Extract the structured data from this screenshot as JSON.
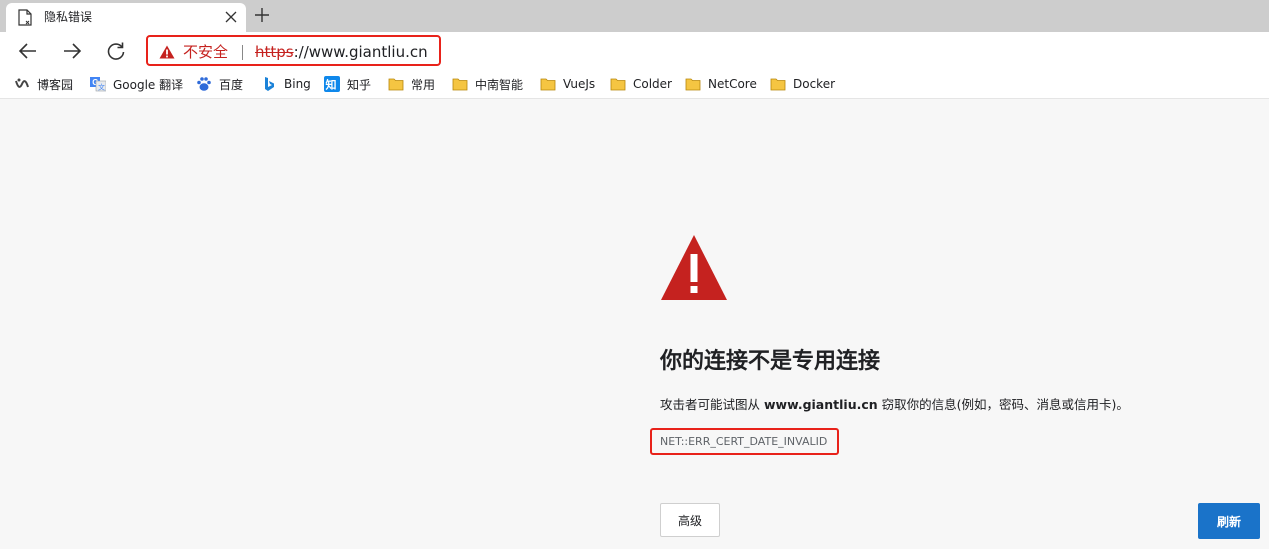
{
  "tab": {
    "title": "隐私错误",
    "icon": "document-icon"
  },
  "toolbar": {
    "address": {
      "security_label": "不安全",
      "scheme": "https",
      "rest": "://www.giantliu.cn"
    }
  },
  "bookmarks": [
    {
      "label": "博客园",
      "icon": "cnblogs-icon"
    },
    {
      "label": "Google 翻译",
      "icon": "google-translate-icon"
    },
    {
      "label": "百度",
      "icon": "baidu-icon"
    },
    {
      "label": "Bing",
      "icon": "bing-icon"
    },
    {
      "label": "知乎",
      "icon": "zhihu-icon"
    },
    {
      "label": "常用",
      "icon": "folder-icon"
    },
    {
      "label": "中南智能",
      "icon": "folder-icon"
    },
    {
      "label": "VueJs",
      "icon": "folder-icon"
    },
    {
      "label": "Colder",
      "icon": "folder-icon"
    },
    {
      "label": "NetCore",
      "icon": "folder-icon"
    },
    {
      "label": "Docker",
      "icon": "folder-icon"
    }
  ],
  "error": {
    "heading": "你的连接不是专用连接",
    "desc_before": "攻击者可能试图从 ",
    "desc_site": "www.giantliu.cn",
    "desc_after": " 窃取你的信息(例如，密码、消息或信用卡)。",
    "code": "NET::ERR_CERT_DATE_INVALID"
  },
  "buttons": {
    "advanced": "高级",
    "reload": "刷新"
  },
  "colors": {
    "warning_red": "#c5221f",
    "highlight_red": "#e8221a",
    "primary_blue": "#1a73c9",
    "folder_yellow": "#f5c542"
  }
}
